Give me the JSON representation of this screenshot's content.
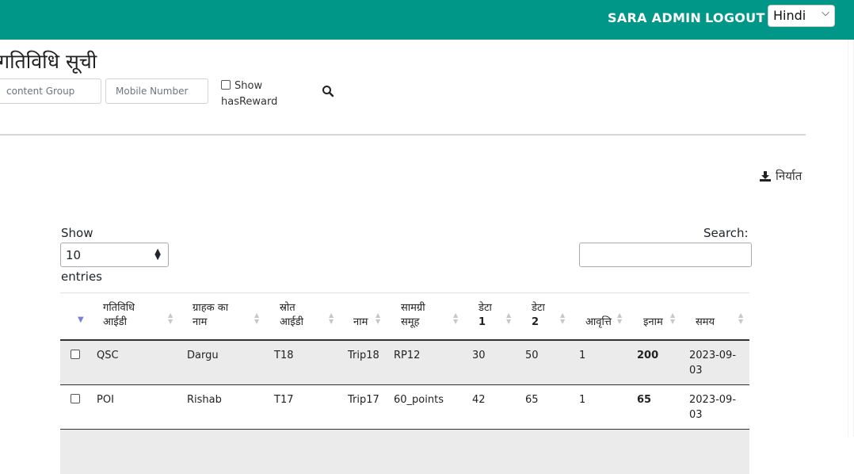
{
  "header": {
    "user_label": "SARA ADMIN",
    "logout_label": "LOGOUT",
    "language": "Hindi",
    "bg_color": "#009688"
  },
  "page": {
    "title": "गतिविधि सूची"
  },
  "filters": {
    "content_group_placeholder": "content Group",
    "mobile_placeholder": "Mobile Number",
    "has_reward_line1": "Show",
    "has_reward_line2": "hasReward",
    "has_reward_checked": false
  },
  "export_label": "निर्यात",
  "table_controls": {
    "show_label": "Show",
    "page_size": "10",
    "entries_label": "entries",
    "search_label": "Search:",
    "search_value": ""
  },
  "columns": [
    {
      "l1": "गतिविधि",
      "l2": "आईडी"
    },
    {
      "l1": "ग्राहक का",
      "l2": "नाम"
    },
    {
      "l1": "स्रोत",
      "l2": "आईडी"
    },
    {
      "l1": "",
      "l2": "नाम"
    },
    {
      "l1": "सामग्री",
      "l2": "समूह"
    },
    {
      "l1": "डेटा",
      "l2": "1"
    },
    {
      "l1": "डेटा",
      "l2": "2"
    },
    {
      "l1": "",
      "l2": "आवृत्ति"
    },
    {
      "l1": "",
      "l2": "इनाम"
    },
    {
      "l1": "",
      "l2": "समय"
    }
  ],
  "rows": [
    {
      "activity_id": "QSC",
      "customer": "Dargu",
      "source_id": "T18",
      "name": "Trip18",
      "content_group": "RP12",
      "data1": "30",
      "data2": "50",
      "frequency": "1",
      "reward": "200",
      "time_l1": "2023-09-",
      "time_l2": "03"
    },
    {
      "activity_id": "POI",
      "customer": "Rishab",
      "source_id": "T17",
      "name": "Trip17",
      "content_group": "60_points",
      "data1": "42",
      "data2": "65",
      "frequency": "1",
      "reward": "65",
      "time_l1": "2023-09-",
      "time_l2": "03"
    }
  ]
}
